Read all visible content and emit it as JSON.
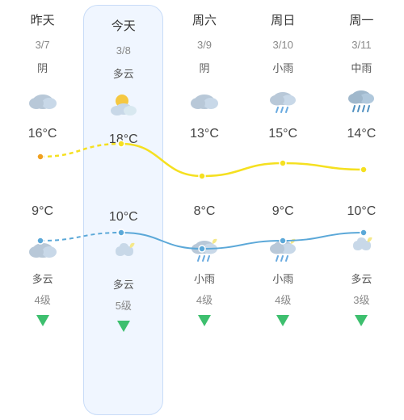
{
  "days": [
    {
      "id": "yesterday",
      "name": "昨天",
      "date": "3/7",
      "condition": "阴",
      "iconDay": "cloud",
      "highTemp": "16°C",
      "lowTemp": "9°C",
      "iconNight": "cloud",
      "nightCondition": "多云",
      "windLevel": "4级",
      "isToday": false
    },
    {
      "id": "today",
      "name": "今天",
      "date": "3/8",
      "condition": "多云",
      "iconDay": "partly-cloudy",
      "highTemp": "18°C",
      "lowTemp": "10°C",
      "iconNight": "cloud-moon",
      "nightCondition": "多云",
      "windLevel": "5级",
      "isToday": true
    },
    {
      "id": "sat",
      "name": "周六",
      "date": "3/9",
      "condition": "阴",
      "iconDay": "cloud",
      "highTemp": "13°C",
      "lowTemp": "8°C",
      "iconNight": "rain-light",
      "nightCondition": "小雨",
      "windLevel": "4级",
      "isToday": false
    },
    {
      "id": "sun",
      "name": "周日",
      "date": "3/10",
      "condition": "小雨",
      "iconDay": "rain-light",
      "highTemp": "15°C",
      "lowTemp": "9°C",
      "iconNight": "rain-light",
      "nightCondition": "小雨",
      "windLevel": "4级",
      "isToday": false
    },
    {
      "id": "mon",
      "name": "周一",
      "date": "3/11",
      "condition": "中雨",
      "iconDay": "rain",
      "highTemp": "14°C",
      "lowTemp": "10°C",
      "iconNight": "cloud-moon",
      "nightCondition": "多云",
      "windLevel": "3级",
      "isToday": false
    }
  ],
  "highTemps": [
    16,
    18,
    13,
    15,
    14
  ],
  "lowTemps": [
    9,
    10,
    8,
    9,
    10
  ],
  "colors": {
    "highLine": "#f5e642",
    "lowLine": "#6ab0e0",
    "today_bg": "#eef4ff",
    "today_border": "#c5d9f5",
    "arrow_green": "#3dbf6e"
  }
}
